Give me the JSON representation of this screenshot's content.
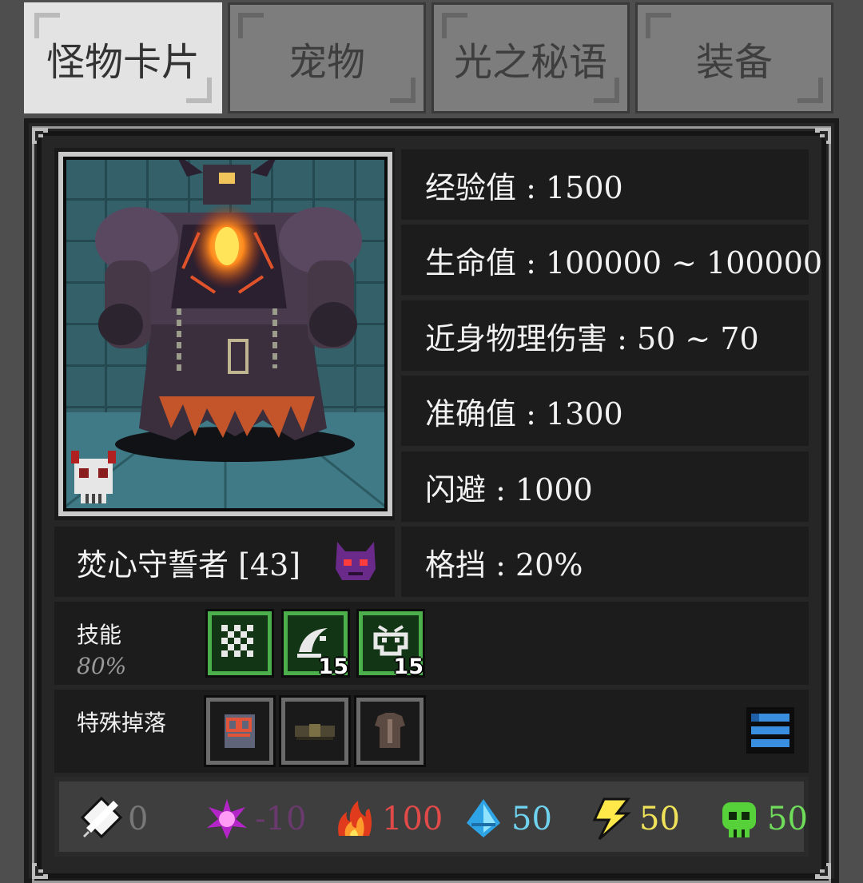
{
  "tabs": [
    {
      "label": "怪物卡片",
      "active": true
    },
    {
      "label": "宠物",
      "active": false
    },
    {
      "label": "光之秘语",
      "active": false
    },
    {
      "label": "装备",
      "active": false
    }
  ],
  "stats": {
    "exp": "经验值 : 1500",
    "hp": "生命值 : 100000 ~ 100000",
    "melee": "近身物理伤害 : 50 ~ 70",
    "accuracy": "准确值 : 1300",
    "evasion": "闪避 : 1000",
    "block": "格挡 : 20%"
  },
  "monster": {
    "name": "焚心守誓者 [43]",
    "race_icon": "demon-face-icon"
  },
  "skills": {
    "label": "技能",
    "chance": "80%",
    "items": [
      {
        "icon": "grid-rune-icon",
        "count": ""
      },
      {
        "icon": "crescent-slash-icon",
        "count": "15"
      },
      {
        "icon": "spirit-face-icon",
        "count": "15"
      }
    ]
  },
  "drops": {
    "label": "特殊掉落",
    "items": [
      {
        "icon": "scroll-icon"
      },
      {
        "icon": "belt-icon"
      },
      {
        "icon": "armor-icon"
      }
    ],
    "list_button_icon": "list-icon"
  },
  "resistances": [
    {
      "icon": "sword-icon",
      "value": "0",
      "color": "#777777"
    },
    {
      "icon": "dark-orb-icon",
      "value": "-10",
      "color": "#6a3a6e"
    },
    {
      "icon": "fire-icon",
      "value": "100",
      "color": "#e24a4a"
    },
    {
      "icon": "water-drop-icon",
      "value": "50",
      "color": "#6fd3f0"
    },
    {
      "icon": "lightning-icon",
      "value": "50",
      "color": "#f0e35a"
    },
    {
      "icon": "poison-skull-icon",
      "value": "50",
      "color": "#6fdc5a"
    }
  ]
}
